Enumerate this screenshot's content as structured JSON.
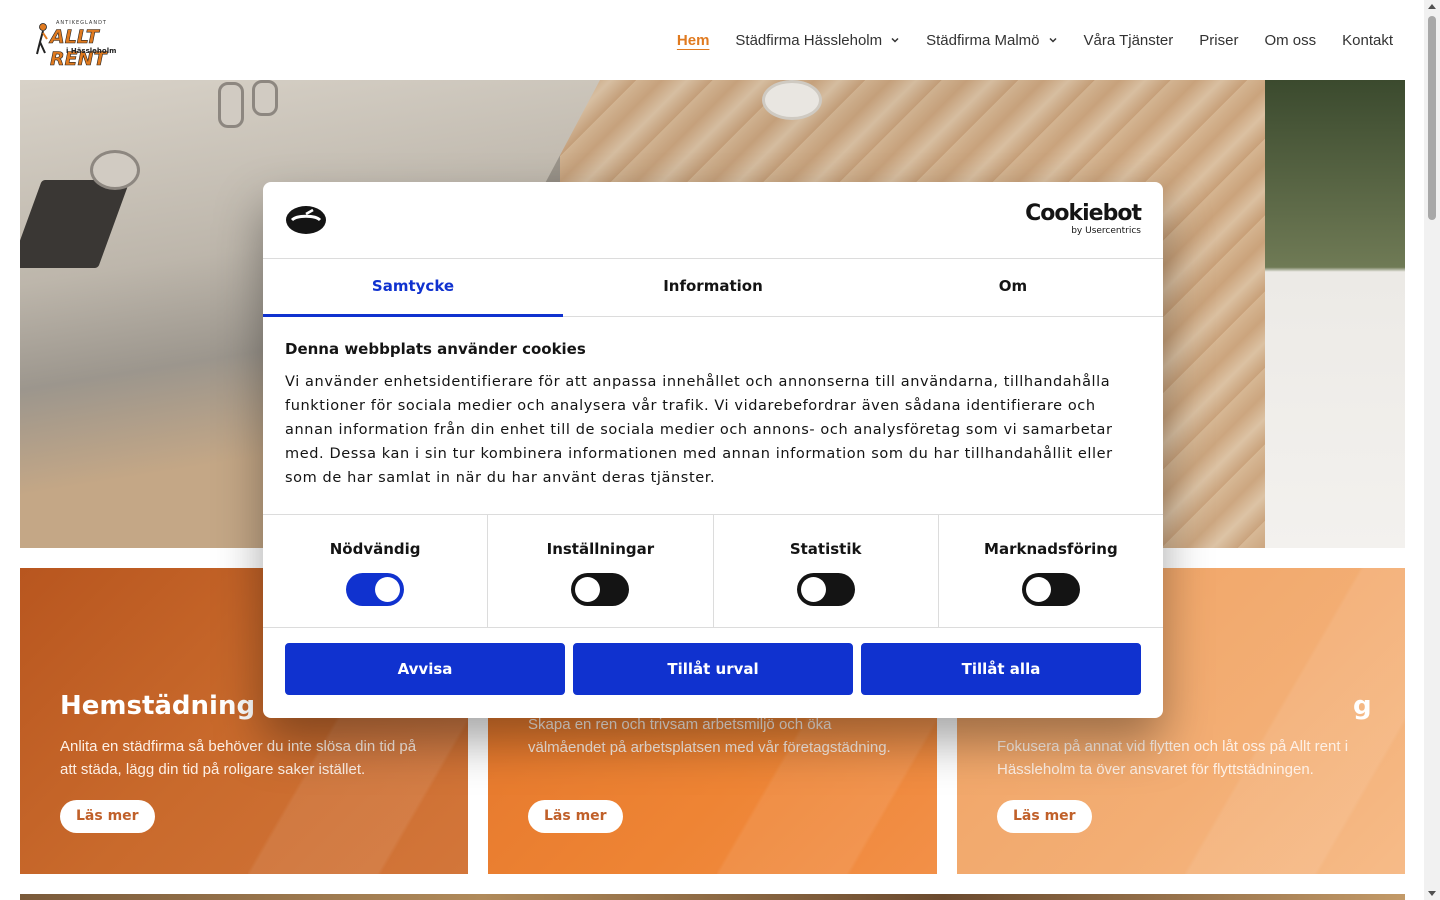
{
  "site": {
    "logo": {
      "top_text": "ANTIKEGLANDT",
      "main_text": "ALLT RENT",
      "sub_text": "i Hässleholm"
    },
    "nav": [
      {
        "label": "Hem",
        "active": true,
        "dropdown": false
      },
      {
        "label": "Städfirma Hässleholm",
        "active": false,
        "dropdown": true
      },
      {
        "label": "Städfirma Malmö",
        "active": false,
        "dropdown": true
      },
      {
        "label": "Våra Tjänster",
        "active": false,
        "dropdown": false
      },
      {
        "label": "Priser",
        "active": false,
        "dropdown": false
      },
      {
        "label": "Om oss",
        "active": false,
        "dropdown": false
      },
      {
        "label": "Kontakt",
        "active": false,
        "dropdown": false
      }
    ],
    "accent_color": "#e07a1f"
  },
  "cards": [
    {
      "title": "Hemstädning",
      "description": "Anlita en städfirma så behöver du inte slösa din tid på att städa, lägg din tid på roligare saker istället.",
      "button": "Läs mer"
    },
    {
      "title": "",
      "description": "Skapa en ren och trivsam arbetsmiljö och öka välmåendet på arbetsplatsen med vår företagstädning.",
      "button": "Läs mer"
    },
    {
      "title": "g",
      "description": "Fokusera på annat vid flytten och låt oss på Allt rent i Hässleholm ta över ansvaret för flyttstädningen.",
      "button": "Läs mer"
    }
  ],
  "cookie_dialog": {
    "brand": "Cookiebot",
    "brand_sub": "by Usercentrics",
    "tabs": [
      {
        "label": "Samtycke",
        "active": true
      },
      {
        "label": "Information",
        "active": false
      },
      {
        "label": "Om",
        "active": false
      }
    ],
    "heading": "Denna webbplats använder cookies",
    "body": "Vi använder enhetsidentifierare för att anpassa innehållet och annonserna till användarna, tillhandahålla funktioner för sociala medier och analysera vår trafik. Vi vidarebefordrar även sådana identifierare och annan information från din enhet till de sociala medier och annons- och analysföretag som vi samarbetar med. Dessa kan i sin tur kombinera informationen med annan information som du har tillhandahållit eller som de har samlat in när du har använt deras tjänster.",
    "toggles": [
      {
        "label": "Nödvändig",
        "on": true
      },
      {
        "label": "Inställningar",
        "on": false
      },
      {
        "label": "Statistik",
        "on": false
      },
      {
        "label": "Marknadsföring",
        "on": false
      }
    ],
    "buttons": {
      "reject": "Avvisa",
      "allow_selection": "Tillåt urval",
      "allow_all": "Tillåt alla"
    },
    "primary_color": "#1032cf"
  }
}
